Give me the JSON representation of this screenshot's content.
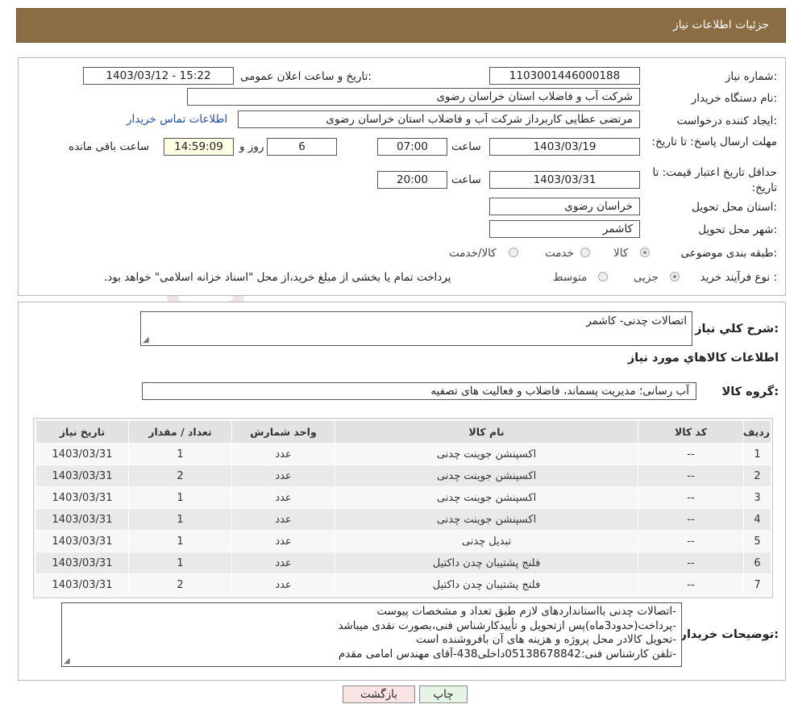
{
  "header": {
    "title": "جزئیات اطلاعات نیاز"
  },
  "form": {
    "need_number_label": "شماره نیاز:",
    "need_number": "1103001446000188",
    "announce_label": "تاریخ و ساعت اعلان عمومی:",
    "announce_value": "1403/03/12 - 15:22",
    "buyer_org_label": "نام دستگاه خریدار:",
    "buyer_org": "شرکت آب و فاضلاب استان خراسان رضوی",
    "creator_label": "ایجاد کننده درخواست:",
    "creator": "مرتضی عطایی کاربرداز شرکت آب و فاضلاب استان خراسان رضوی",
    "contact_link": "اطلاعات تماس خریدار",
    "deadline_label": "مهلت ارسال پاسخ: تا تاریخ:",
    "deadline_date": "1403/03/19",
    "time_word": "ساعت",
    "deadline_time": "07:00",
    "remain_days": "6",
    "day_and": "روز و",
    "remain_time": "14:59:09",
    "remain_label": "ساعت باقی مانده",
    "price_valid_label": "حداقل تاریخ اعتبار قیمت: تا تاریخ:",
    "price_valid_date": "1403/03/31",
    "price_valid_time": "20:00",
    "province_label": "استان محل تحویل:",
    "province": "خراسان رضوی",
    "city_label": "شهر محل تحویل:",
    "city": "کاشمر",
    "category_label": "طبقه بندی موضوعی:",
    "category_options": [
      "کالا",
      "خدمت",
      "کالا/خدمت"
    ],
    "process_label": "نوع فرآیند خرید :",
    "process_options": [
      "جزیی",
      "متوسط"
    ],
    "process_note": "پرداخت تمام یا بخشی از مبلغ خرید،از محل \"اسناد خزانه اسلامی\" خواهد بود."
  },
  "details": {
    "summary_label": "شرح کلي نياز:",
    "summary": "اتصالات چدنی- کاشمر",
    "goods_info_title": "اطلاعات کالاهاي مورد نياز",
    "group_label": "گروه کالا:",
    "group": "آب رسانی؛ مدیریت پسماند، فاضلاب و فعالیت های تصفیه",
    "table": {
      "headers": [
        "رديف",
        "کد کالا",
        "نام کالا",
        "واحد شمارش",
        "تعداد / مقدار",
        "تاریخ نیاز"
      ],
      "rows": [
        [
          "1",
          "--",
          "اکسپنشن جوینت چدنی",
          "عدد",
          "1",
          "1403/03/31"
        ],
        [
          "2",
          "--",
          "اکسپنشن جوینت چدنی",
          "عدد",
          "2",
          "1403/03/31"
        ],
        [
          "3",
          "--",
          "اکسپنشن جوینت چدنی",
          "عدد",
          "1",
          "1403/03/31"
        ],
        [
          "4",
          "--",
          "اکسپنشن جوینت چدنی",
          "عدد",
          "1",
          "1403/03/31"
        ],
        [
          "5",
          "--",
          "تبدیل چدنی",
          "عدد",
          "1",
          "1403/03/31"
        ],
        [
          "6",
          "--",
          "فلنج پشتیبان چدن داکتیل",
          "عدد",
          "1",
          "1403/03/31"
        ],
        [
          "7",
          "--",
          "فلنج پشتیبان چدن داکتیل",
          "عدد",
          "2",
          "1403/03/31"
        ]
      ]
    },
    "buyer_notes_label": "توضيحات خريدار:",
    "buyer_notes": [
      "-اتصالات چدنی بااستانداردهای لازم طبق تعداد و مشخصات پیوست",
      "-پرداخت(حدود3ماه)پس ازتحویل و تأییدکارشناس فنی،بصورت نقدی میباشد",
      "-تحویل کالادر محل پروژه و هزینه های آن بافروشنده است",
      "-تلفن کارشناس فنی:05138678842داخلی438-آقای مهندس امامی مقدم"
    ]
  },
  "buttons": {
    "print": "چاپ",
    "back": "بازگشت"
  },
  "watermark": {
    "text": "AriaTender.neT"
  }
}
